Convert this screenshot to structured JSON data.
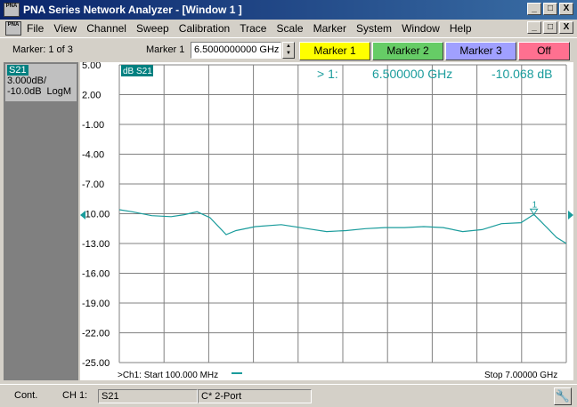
{
  "app": {
    "title": "PNA Series Network Analyzer - [Window 1 ]",
    "icon_text": "PNA",
    "window_buttons": [
      "_",
      "□",
      "X"
    ],
    "doc_buttons": [
      "_",
      "□",
      "X"
    ]
  },
  "menu": [
    "File",
    "View",
    "Channel",
    "Sweep",
    "Calibration",
    "Trace",
    "Scale",
    "Marker",
    "System",
    "Window",
    "Help"
  ],
  "toolbar": {
    "marker_count": "Marker: 1 of 3",
    "marker_label": "Marker 1",
    "marker_value": "6.5000000000 GHz",
    "buttons": [
      {
        "label": "Marker 1",
        "color": "#ffff00"
      },
      {
        "label": "Marker 2",
        "color": "#66cc66"
      },
      {
        "label": "Marker 3",
        "color": "#a0a0ff"
      },
      {
        "label": "Off",
        "color": "#ff7090"
      }
    ]
  },
  "trace_panel": {
    "name": "S21",
    "scale": "3.000dB/",
    "ref": "-10.0dB",
    "format": "LogM"
  },
  "chart_data": {
    "type": "line",
    "trace_label": "dB S21",
    "marker_readout": {
      "prefix": "> 1:",
      "freq": "6.500000 GHz",
      "value": "-10.068 dB"
    },
    "marker_tag": "1",
    "ref_level": -10.0,
    "ylim": [
      -25.0,
      5.0
    ],
    "yticks": [
      "5.00",
      "2.00",
      "-1.00",
      "-4.00",
      "-7.00",
      "-10.00",
      "-13.00",
      "-16.00",
      "-19.00",
      "-22.00",
      "-25.00"
    ],
    "xlim": [
      0.1,
      7.0
    ],
    "x_unit": "GHz",
    "start_label": ">Ch1: Start  100.000 MHz",
    "stop_label": "Stop  7.00000 GHz",
    "grid": true,
    "trace_color": "#1a9c9c",
    "series": [
      {
        "x": [
          0.1,
          0.3,
          0.6,
          0.9,
          1.1,
          1.3,
          1.5,
          1.75,
          1.9,
          2.2,
          2.6,
          3.0,
          3.3,
          3.6,
          3.9,
          4.2,
          4.5,
          4.8,
          5.1,
          5.4,
          5.7,
          6.0,
          6.3,
          6.5,
          6.7,
          6.85,
          7.0
        ],
        "y": [
          -9.6,
          -9.8,
          -10.2,
          -10.3,
          -10.1,
          -9.8,
          -10.4,
          -12.1,
          -11.7,
          -11.3,
          -11.1,
          -11.5,
          -11.8,
          -11.7,
          -11.5,
          -11.4,
          -11.4,
          -11.3,
          -11.4,
          -11.8,
          -11.6,
          -11.0,
          -10.9,
          -10.07,
          -11.4,
          -12.4,
          -13.0
        ]
      }
    ],
    "marker": {
      "x": 6.5,
      "y": -10.068
    }
  },
  "status": {
    "mode": "Cont.",
    "channel": "CH 1:",
    "trace": "S21",
    "cal": "C* 2-Port"
  }
}
